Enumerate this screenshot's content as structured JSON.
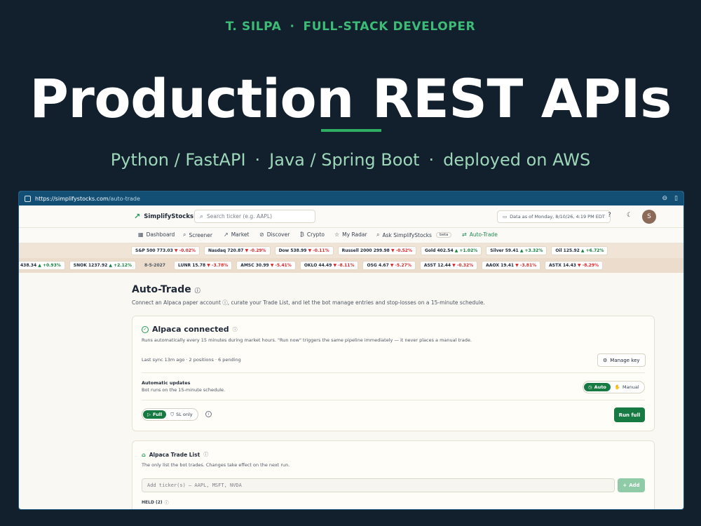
{
  "slide": {
    "kicker_name": "T. SILPA",
    "kicker_sep": "·",
    "kicker_role": "FULL-STACK DEVELOPER",
    "headline": "Production REST APIs",
    "stack_1": "Python / FastAPI",
    "stack_sep": "·",
    "stack_2": "Java / Spring Boot",
    "stack_3": "deployed on AWS"
  },
  "browser": {
    "url_host": "https://simplifystocks.com",
    "url_path": "/auto-trade"
  },
  "header": {
    "logo": "SimplifyStocks",
    "search_placeholder": "Search ticker (e.g. AAPL)",
    "as_of": "Data as of Monday, 8/10/26, 4:19 PM EDT",
    "avatar_initial": "S"
  },
  "tabs": [
    {
      "label": "Dashboard",
      "icon": "grid-icon"
    },
    {
      "label": "Screener",
      "icon": "search-icon"
    },
    {
      "label": "Market",
      "icon": "trend-icon"
    },
    {
      "label": "Discover",
      "icon": "compass-icon"
    },
    {
      "label": "Crypto",
      "icon": "bitcoin-icon"
    },
    {
      "label": "My Radar",
      "icon": "star-icon"
    },
    {
      "label": "Ask SimplifyStocks",
      "icon": "search-icon",
      "badge": "beta"
    },
    {
      "label": "Auto-Trade",
      "icon": "swap-icon",
      "active": true
    }
  ],
  "indices": [
    {
      "name": "S&P 500",
      "value": "773.03",
      "change": "▼ -0.02%",
      "dir": "dn"
    },
    {
      "name": "Nasdaq",
      "value": "720.87",
      "change": "▼ -0.29%",
      "dir": "dn"
    },
    {
      "name": "Dow",
      "value": "538.99",
      "change": "▼ -0.11%",
      "dir": "dn"
    },
    {
      "name": "Russell 2000",
      "value": "299.98",
      "change": "▼ -0.52%",
      "dir": "dn"
    },
    {
      "name": "Gold",
      "value": "402.54",
      "change": "▲ +1.02%",
      "dir": "up"
    },
    {
      "name": "Silver",
      "value": "59.41",
      "change": "▲ +3.32%",
      "dir": "up"
    },
    {
      "name": "Oil",
      "value": "125.92",
      "change": "▲ +6.72%",
      "dir": "up"
    }
  ],
  "tickers": [
    {
      "name": "",
      "value": "438.34",
      "change": "▲ +0.93%",
      "dir": "up"
    },
    {
      "name": "SNOK",
      "value": "1237.92",
      "change": "▲ +2.12%",
      "dir": "up"
    },
    {
      "plain": "8-5-2027"
    },
    {
      "name": "LUNR",
      "value": "15.78",
      "change": "▼ -3.78%",
      "dir": "dn"
    },
    {
      "name": "AMSC",
      "value": "30.99",
      "change": "▼ -5.41%",
      "dir": "dn"
    },
    {
      "name": "OKLO",
      "value": "44.49",
      "change": "▼ -8.11%",
      "dir": "dn"
    },
    {
      "name": "OSG",
      "value": "4.67",
      "change": "▼ -5.27%",
      "dir": "dn"
    },
    {
      "name": "ASST",
      "value": "12.44",
      "change": "▼ -0.32%",
      "dir": "dn"
    },
    {
      "name": "AAOX",
      "value": "19.41",
      "change": "▼ -3.81%",
      "dir": "dn"
    },
    {
      "name": "ASTX",
      "value": "14.43",
      "change": "▼ -8.29%",
      "dir": "dn"
    }
  ],
  "main": {
    "title": "Auto-Trade",
    "desc": "Connect an Alpaca paper account ⓘ, curate your Trade List, and let the bot manage entries and stop-losses on a 15-minute schedule."
  },
  "connection": {
    "title": "Alpaca connected",
    "desc": "Runs automatically every 15 minutes during market hours. \"Run now\" triggers the same pipeline immediately — it never places a manual trade.",
    "sync": "Last sync 13m ago · 2 positions · 6 pending",
    "manage_key": "Manage key",
    "auto_title": "Automatic updates",
    "auto_desc": "Bot runs on the 15-minute schedule.",
    "mode_auto": "Auto",
    "mode_manual": "Manual",
    "run_full": "Full",
    "run_sl": "SL only",
    "run_button": "Run full"
  },
  "trade_list": {
    "title": "Alpaca Trade List",
    "desc": "The only list the bot trades. Changes take effect on the next run.",
    "input_placeholder": "Add ticker(s) — AAPL, MSFT, NVDA",
    "add_button": "Add",
    "held_label": "HELD (2)"
  },
  "colors": {
    "background": "#11202c",
    "accent": "#2fae63",
    "primary_button": "#177a43",
    "up": "#15803d",
    "down": "#dc2626"
  }
}
